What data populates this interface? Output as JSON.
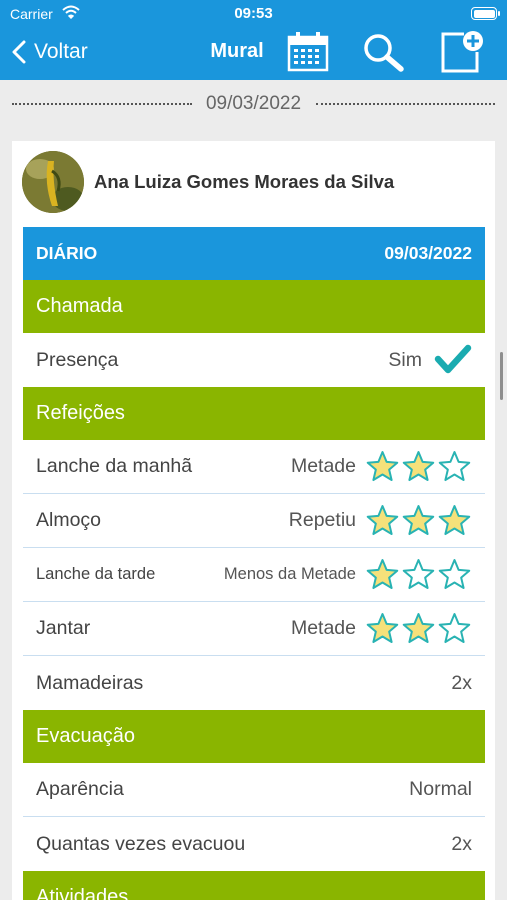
{
  "status_bar": {
    "carrier": "Carrier",
    "time": "09:53"
  },
  "nav": {
    "back_label": "Voltar",
    "title": "Mural",
    "icons": [
      "calendar-icon",
      "search-icon",
      "new-post-icon"
    ]
  },
  "feed": {
    "date_separator": "09/03/2022"
  },
  "post": {
    "student_name": "Ana Luiza Gomes Moraes da Silva",
    "diary": {
      "title": "DIÁRIO",
      "date": "09/03/2022",
      "chamada": {
        "title": "Chamada",
        "presenca": {
          "label": "Presença",
          "value": "Sim"
        }
      },
      "refeicoes": {
        "title": "Refeições",
        "items": [
          {
            "label": "Lanche da manhã",
            "value": "Metade",
            "rating": 2,
            "max": 3
          },
          {
            "label": "Almoço",
            "value": "Repetiu",
            "rating": 3,
            "max": 3
          },
          {
            "label": "Lanche da tarde",
            "value": "Menos da Metade",
            "rating": 1,
            "max": 3
          },
          {
            "label": "Jantar",
            "value": "Metade",
            "rating": 2,
            "max": 3
          }
        ],
        "mamadeiras": {
          "label": "Mamadeiras",
          "value": "2x"
        }
      },
      "evacuacao": {
        "title": "Evacuação",
        "aparencia": {
          "label": "Aparência",
          "value": "Normal"
        },
        "vezes": {
          "label": "Quantas vezes evacuou",
          "value": "2x"
        }
      },
      "atividades": {
        "title": "Atividades"
      }
    }
  },
  "colors": {
    "header_blue": "#1a96dc",
    "section_green": "#8ab500",
    "star_fill": "#f5e17a",
    "star_stroke": "#29b3b3",
    "check": "#1aabb0"
  }
}
